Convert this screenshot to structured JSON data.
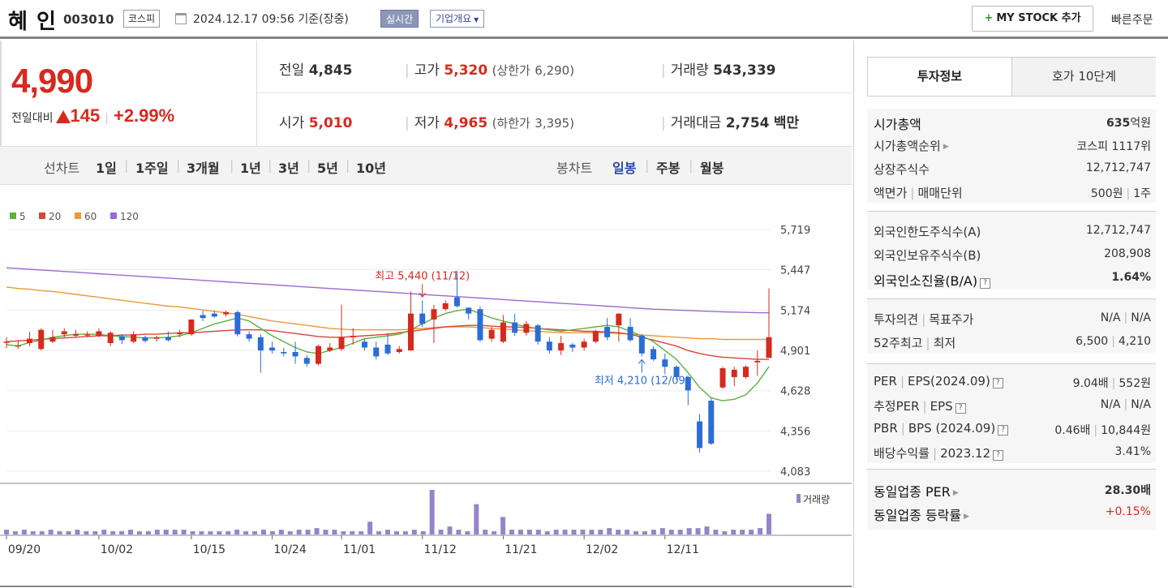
{
  "header": {
    "name": "혜 인",
    "code": "003010",
    "market": "코스피",
    "datetime": "2024.12.17 09:56  기준(장중)",
    "realtime": "실시간",
    "overview": "기업개요",
    "mystock": "MY STOCK 추가",
    "mystock_plus": "+",
    "quick_order": "빠른주문"
  },
  "price": {
    "current": "4,990",
    "diff_label": "전일대비",
    "diff_value": "145",
    "diff_pct": "+2.99%"
  },
  "info": {
    "prev_label": "전일",
    "prev_value": "4,845",
    "high_label": "고가",
    "high_value": "5,320",
    "upper_label": "(상한가",
    "upper_value": "6,290)",
    "volume_label": "거래량",
    "volume_value": "543,339",
    "open_label": "시가",
    "open_value": "5,010",
    "low_label": "저가",
    "low_value": "4,965",
    "lower_label": "(하한가",
    "lower_value": "3,395)",
    "amount_label": "거래대금",
    "amount_value": "2,754",
    "amount_unit": "백만"
  },
  "toolbar": {
    "line_chart": "선차트",
    "periods": [
      "1일",
      "1주일",
      "3개월",
      "1년",
      "3년",
      "5년",
      "10년"
    ],
    "candle_chart": "봉차트",
    "candle_periods": [
      "일봉",
      "주봉",
      "월봉"
    ],
    "selected_candle": "일봉"
  },
  "right_panel": {
    "tab_active": "투자정보",
    "tab_inactive": "호가 10단계",
    "rows_a": [
      {
        "k": "시가총액",
        "v1": "635",
        "v2": "억원"
      },
      {
        "k": "시가총액순위",
        "v": "코스피 1117위"
      },
      {
        "k": "상장주식수",
        "v": "12,712,747"
      },
      {
        "k1": "액면가",
        "k2": "매매단위",
        "v1": "500원",
        "v2": "1주"
      }
    ],
    "rows_b": [
      {
        "k": "외국인한도주식수(A)",
        "v": "12,712,747"
      },
      {
        "k": "외국인보유주식수(B)",
        "v": "208,908"
      },
      {
        "k": "외국인소진율(B/A)",
        "v": "1.64%"
      }
    ],
    "rows_c": [
      {
        "k1": "투자의견",
        "k2": "목표주가",
        "v1": "N/A",
        "v2": "N/A"
      },
      {
        "k1": "52주최고",
        "k2": "최저",
        "v1": "6,500",
        "v2": "4,210"
      }
    ],
    "rows_d": [
      {
        "k1": "PER",
        "k2": "EPS(2024.09)",
        "v1": "9.04배",
        "v2": "552원"
      },
      {
        "k1": "추정PER",
        "k2": "EPS",
        "v1": "N/A",
        "v2": "N/A"
      },
      {
        "k1": "PBR",
        "k2": "BPS (2024.09)",
        "v1": "0.46배",
        "v2": "10,844원"
      },
      {
        "k1": "배당수익률",
        "k2": "2023.12",
        "v": "3.41%"
      }
    ],
    "rows_e": [
      {
        "k": "동일업종 PER",
        "v": "28.30배"
      },
      {
        "k": "동일업종 등락률",
        "v": "+0.15%"
      }
    ],
    "qmark": "?"
  },
  "chart_data": {
    "type": "candlestick",
    "legend": [
      {
        "name": "5",
        "color": "#5cb040"
      },
      {
        "name": "20",
        "color": "#d9443a"
      },
      {
        "name": "60",
        "color": "#e89a3a"
      },
      {
        "name": "120",
        "color": "#9c6ad0"
      }
    ],
    "y_ticks": [
      "5,719",
      "5,447",
      "5,174",
      "4,901",
      "4,628",
      "4,356",
      "4,083"
    ],
    "ylim": [
      4083,
      5719
    ],
    "x_ticks": [
      "09/20",
      "10/02",
      "10/15",
      "10/24",
      "11/01",
      "11/12",
      "11/21",
      "12/02",
      "12/11"
    ],
    "x_tick_index": [
      0,
      8,
      16,
      23,
      29,
      36,
      43,
      50,
      57
    ],
    "volume_label": "거래량",
    "high_annotation": "최고 5,440 (11/12)",
    "low_annotation": "최저 4,210 (12/09)",
    "high_index": 36,
    "low_index": 55,
    "candles": [
      [
        4955,
        4960,
        4990,
        4915
      ],
      [
        4930,
        4935,
        4970,
        4910
      ],
      [
        4950,
        4980,
        5025,
        4930
      ],
      [
        4910,
        5040,
        5050,
        4900
      ],
      [
        4960,
        4990,
        5040,
        4950
      ],
      [
        5010,
        5030,
        5050,
        4990
      ],
      [
        5000,
        5010,
        5040,
        4990
      ],
      [
        5010,
        5010,
        5030,
        4990
      ],
      [
        5000,
        5030,
        5050,
        4990
      ],
      [
        4950,
        5020,
        5030,
        4930
      ],
      [
        4995,
        4970,
        5010,
        4945
      ],
      [
        4960,
        5010,
        5030,
        4950
      ],
      [
        4990,
        4965,
        5000,
        4955
      ],
      [
        4980,
        4990,
        5000,
        4960
      ],
      [
        4990,
        4970,
        5030,
        4960
      ],
      [
        5010,
        5020,
        5040,
        4990
      ],
      [
        5010,
        5110,
        5110,
        5000
      ],
      [
        5140,
        5120,
        5170,
        5100
      ],
      [
        5150,
        5130,
        5170,
        5120
      ],
      [
        5145,
        5160,
        5170,
        5130
      ],
      [
        5160,
        5010,
        5170,
        4995
      ],
      [
        5010,
        4980,
        5030,
        4960
      ],
      [
        4990,
        4900,
        5010,
        4750
      ],
      [
        4920,
        4900,
        4960,
        4880
      ],
      [
        4890,
        4880,
        4920,
        4860
      ],
      [
        4890,
        4860,
        4960,
        4810
      ],
      [
        4850,
        4810,
        4870,
        4790
      ],
      [
        4810,
        4930,
        4940,
        4800
      ],
      [
        4900,
        4920,
        4950,
        4890
      ],
      [
        4910,
        4990,
        5210,
        4900
      ],
      [
        4990,
        5000,
        5050,
        4940
      ],
      [
        4960,
        4920,
        4980,
        4900
      ],
      [
        4920,
        4860,
        4960,
        4840
      ],
      [
        4940,
        4880,
        5020,
        4870
      ],
      [
        4890,
        4910,
        4930,
        4880
      ],
      [
        4900,
        5150,
        5300,
        4900
      ],
      [
        5150,
        5080,
        5240,
        5060
      ],
      [
        5110,
        5180,
        5210,
        4950
      ],
      [
        5180,
        5220,
        5240,
        5170
      ],
      [
        5260,
        5200,
        5440,
        5190
      ],
      [
        5190,
        5150,
        5180,
        5110
      ],
      [
        5180,
        4970,
        5200,
        4960
      ],
      [
        4980,
        5040,
        5060,
        4960
      ],
      [
        4960,
        5090,
        5140,
        4950
      ],
      [
        5090,
        5020,
        5150,
        5000
      ],
      [
        5020,
        5080,
        5100,
        5000
      ],
      [
        5070,
        4960,
        5080,
        4940
      ],
      [
        4960,
        4900,
        4990,
        4880
      ],
      [
        4900,
        4950,
        5000,
        4870
      ],
      [
        4940,
        4920,
        4950,
        4890
      ],
      [
        4920,
        4960,
        4980,
        4900
      ],
      [
        4960,
        5030,
        5040,
        4950
      ],
      [
        5060,
        4990,
        5120,
        4970
      ],
      [
        5070,
        5150,
        5150,
        4960
      ],
      [
        5060,
        4970,
        5120,
        4960
      ],
      [
        5000,
        4880,
        5010,
        4860
      ],
      [
        4910,
        4840,
        4930,
        4830
      ],
      [
        4840,
        4790,
        4880,
        4740
      ],
      [
        4790,
        4720,
        4800,
        4700
      ],
      [
        4720,
        4630,
        4730,
        4530
      ],
      [
        4420,
        4240,
        4470,
        4210
      ],
      [
        4560,
        4270,
        4580,
        4260
      ],
      [
        4650,
        4780,
        4790,
        4640
      ],
      [
        4720,
        4770,
        4790,
        4660
      ],
      [
        4720,
        4790,
        4800,
        4710
      ],
      [
        4820,
        4830,
        4900,
        4730
      ],
      [
        4850,
        4990,
        5320,
        4965
      ]
    ],
    "ma5": [
      4940,
      4930,
      4955,
      4970,
      4990,
      5000,
      5010,
      5010,
      5010,
      5000,
      4995,
      4990,
      4985,
      4985,
      4990,
      5000,
      5020,
      5050,
      5080,
      5100,
      5120,
      5100,
      5050,
      5000,
      4960,
      4920,
      4890,
      4880,
      4900,
      4920,
      4950,
      4980,
      4990,
      5000,
      5010,
      5040,
      5080,
      5120,
      5150,
      5170,
      5180,
      5150,
      5120,
      5100,
      5080,
      5060,
      5050,
      5040,
      5030,
      5040,
      5050,
      5060,
      5070,
      5060,
      5030,
      5000,
      4960,
      4900,
      4840,
      4750,
      4650,
      4580,
      4560,
      4570,
      4600,
      4680,
      4790
    ],
    "ma20": [
      4960,
      4965,
      4970,
      4975,
      4980,
      4985,
      4990,
      4995,
      5000,
      5000,
      5005,
      5005,
      5010,
      5010,
      5015,
      5020,
      5020,
      5025,
      5030,
      5035,
      5040,
      5040,
      5040,
      5035,
      5025,
      5015,
      5005,
      4995,
      4990,
      4990,
      4995,
      5000,
      5005,
      5010,
      5020,
      5030,
      5040,
      5050,
      5060,
      5065,
      5070,
      5070,
      5065,
      5060,
      5060,
      5055,
      5050,
      5045,
      5040,
      5035,
      5030,
      5030,
      5025,
      5020,
      5010,
      4990,
      4970,
      4950,
      4930,
      4900,
      4880,
      4865,
      4855,
      4850,
      4845,
      4840,
      4840
    ],
    "ma60": [
      5330,
      5320,
      5315,
      5305,
      5300,
      5290,
      5280,
      5270,
      5260,
      5250,
      5240,
      5230,
      5220,
      5210,
      5200,
      5195,
      5185,
      5175,
      5165,
      5155,
      5145,
      5130,
      5115,
      5100,
      5090,
      5080,
      5070,
      5060,
      5050,
      5045,
      5040,
      5040,
      5040,
      5040,
      5040,
      5045,
      5050,
      5055,
      5060,
      5060,
      5060,
      5055,
      5050,
      5045,
      5040,
      5035,
      5030,
      5025,
      5020,
      5020,
      5020,
      5020,
      5020,
      5015,
      5010,
      5005,
      5000,
      4995,
      4990,
      4985,
      4980,
      4980,
      4975,
      4975,
      4975,
      4975,
      4975
    ],
    "ma120": [
      5460,
      5455,
      5450,
      5445,
      5440,
      5435,
      5430,
      5425,
      5420,
      5415,
      5410,
      5405,
      5400,
      5395,
      5390,
      5385,
      5380,
      5375,
      5370,
      5365,
      5360,
      5355,
      5350,
      5345,
      5340,
      5335,
      5330,
      5325,
      5320,
      5315,
      5310,
      5305,
      5300,
      5295,
      5290,
      5285,
      5280,
      5275,
      5270,
      5265,
      5260,
      5255,
      5250,
      5245,
      5240,
      5235,
      5230,
      5225,
      5220,
      5215,
      5210,
      5205,
      5200,
      5195,
      5190,
      5185,
      5180,
      5177,
      5174,
      5171,
      5168,
      5165,
      5162,
      5160,
      5158,
      5156,
      5155
    ],
    "volumes": [
      3,
      2,
      3,
      2,
      2,
      3,
      2,
      2,
      3,
      2,
      2,
      3,
      2,
      2,
      3,
      2,
      2,
      3,
      3,
      3,
      3,
      2,
      2,
      2,
      2,
      2,
      3,
      2,
      2,
      3,
      2,
      3,
      2,
      3,
      3,
      4,
      3,
      3,
      2,
      2,
      2,
      8,
      2,
      3,
      2,
      2,
      3,
      2,
      28,
      3,
      5,
      3,
      2,
      19,
      3,
      2,
      11,
      3,
      3,
      3,
      3,
      2,
      3,
      3,
      3,
      3,
      3,
      3,
      4,
      3,
      3,
      2,
      2,
      3,
      4,
      3,
      3,
      4,
      4,
      5,
      3,
      2,
      3,
      3,
      3,
      4,
      13
    ]
  }
}
